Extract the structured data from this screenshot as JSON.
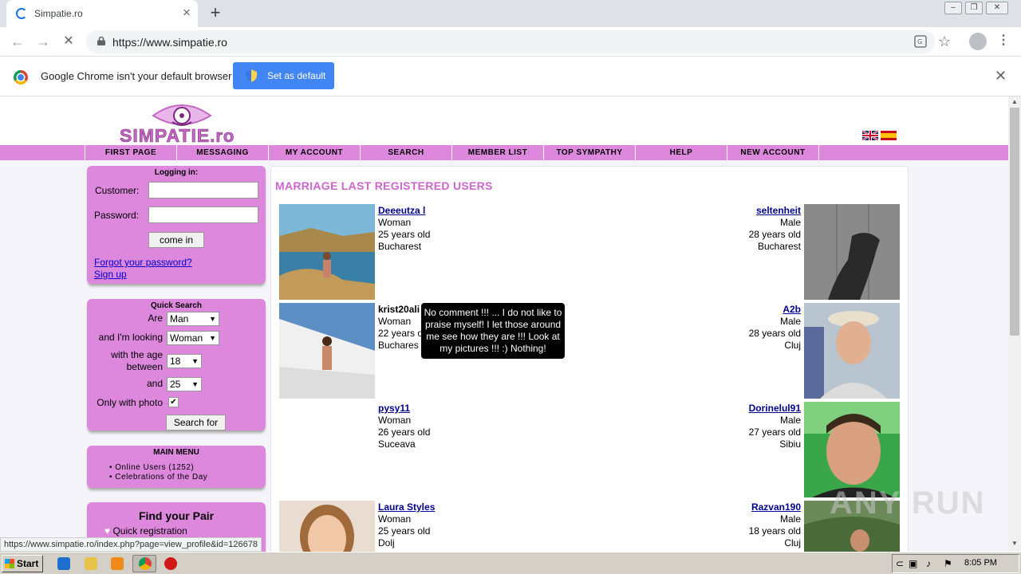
{
  "browser": {
    "tab_title": "Simpatie.ro",
    "url": "https://www.simpatie.ro",
    "infobar_text": "Google Chrome isn't your default browser",
    "set_default_label": "Set as default"
  },
  "site": {
    "logo_text": "SIMPATIE",
    "logo_suffix": ".ro",
    "menu": [
      "FIRST PAGE",
      "MESSAGING",
      "MY ACCOUNT",
      "SEARCH",
      "MEMBER LIST",
      "TOP SYMPATHY",
      "HELP",
      "NEW ACCOUNT"
    ]
  },
  "login": {
    "title": "Logging in:",
    "customer_label": "Customer:",
    "password_label": "Password:",
    "submit": "come in",
    "forgot": "Forgot your password?",
    "signup": "Sign up"
  },
  "quick_search": {
    "title": "Quick Search",
    "are_label": "Are",
    "are_value": "Man",
    "looking_label": "and I'm looking",
    "looking_value": "Woman",
    "age_label_1": "with the age",
    "age_label_2": "between",
    "age_from": "18",
    "and_label": "and",
    "age_to": "25",
    "photo_label": "Only with photo",
    "submit": "Search for"
  },
  "main_menu": {
    "title": "MAIN MENU",
    "items": [
      "Online Users (1252)",
      "Celebrations of the Day"
    ]
  },
  "find_pair": {
    "title": "Find your Pair",
    "item": "Quick registration"
  },
  "content": {
    "title": "MARRIAGE LAST REGISTERED USERS",
    "left_users": [
      {
        "name": "Deeeutza l",
        "gender": "Woman",
        "age": "25 years old",
        "city": "Bucharest"
      },
      {
        "name": "krist20ali",
        "gender": "Woman",
        "age": "22 years o",
        "city": "Buchares"
      },
      {
        "name": "pysy11",
        "gender": "Woman",
        "age": "26 years old",
        "city": "Suceava"
      },
      {
        "name": "Laura Styles",
        "gender": "Woman",
        "age": "25 years old",
        "city": "Dolj"
      }
    ],
    "right_users": [
      {
        "name": "seltenheit",
        "gender": "Male",
        "age": "28 years old",
        "city": "Bucharest"
      },
      {
        "name": "A2b",
        "gender": "Male",
        "age": "28 years old",
        "city": "Cluj"
      },
      {
        "name": "Dorinelul91",
        "gender": "Male",
        "age": "27 years old",
        "city": "Sibiu"
      },
      {
        "name": "Razvan190",
        "gender": "Male",
        "age": "18 years old",
        "city": "Cluj"
      }
    ],
    "tooltip": "No comment !!! ... I do not like to praise myself! I let those around me see how they are !!! Look at my pictures !!! :) Nothing!"
  },
  "status_url": "https://www.simpatie.ro/index.php?page=view_profile&id=126678",
  "taskbar": {
    "start": "Start",
    "clock": "8:05 PM"
  },
  "watermark": "ANY RUN"
}
